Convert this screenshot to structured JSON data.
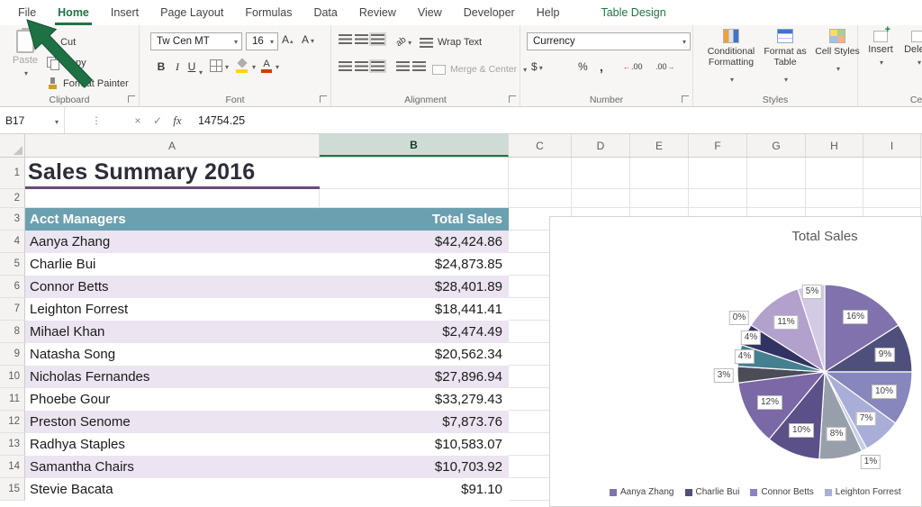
{
  "menu": {
    "tabs": [
      {
        "label": "File"
      },
      {
        "label": "Home",
        "active": true
      },
      {
        "label": "Insert"
      },
      {
        "label": "Page Layout"
      },
      {
        "label": "Formulas"
      },
      {
        "label": "Data"
      },
      {
        "label": "Review"
      },
      {
        "label": "View"
      },
      {
        "label": "Developer"
      },
      {
        "label": "Help"
      },
      {
        "label": "Table Design",
        "contextual": true
      }
    ]
  },
  "ribbon": {
    "clipboard": {
      "label": "Clipboard",
      "paste": "Paste",
      "cut": "Cut",
      "copy": "Copy",
      "format_painter": "Format Painter"
    },
    "font": {
      "label": "Font",
      "font_name": "Tw Cen MT",
      "font_size": "16",
      "bold": "B",
      "italic": "I",
      "underline": "U",
      "grow": "A",
      "shrink": "A"
    },
    "alignment": {
      "label": "Alignment",
      "orientation": "ab",
      "wrap_text": "Wrap Text",
      "merge_center": "Merge & Center"
    },
    "number": {
      "label": "Number",
      "format": "Currency",
      "dollar": "$",
      "percent": "%",
      "comma": ",",
      "decimal": ".00"
    },
    "styles": {
      "label": "Styles",
      "conditional_formatting": "Conditional Formatting",
      "format_as_table": "Format as Table",
      "cell_styles": "Cell Styles"
    },
    "cells": {
      "label": "Cells",
      "insert": "Insert",
      "delete": "Delete"
    }
  },
  "formula_bar": {
    "name_box": "B17",
    "cancel": "×",
    "enter": "✓",
    "fx": "fx",
    "value": "14754.25"
  },
  "sheet": {
    "columns": [
      "A",
      "B",
      "C",
      "D",
      "E",
      "F",
      "G",
      "H",
      "I"
    ],
    "selected_column": "B",
    "title_cell": "Sales Summary 2016",
    "table": {
      "headers": [
        "Acct Managers",
        "Total Sales"
      ],
      "rows": [
        {
          "n": 4,
          "name": "Aanya Zhang",
          "value": "$42,424.86"
        },
        {
          "n": 5,
          "name": "Charlie Bui",
          "value": "$24,873.85"
        },
        {
          "n": 6,
          "name": "Connor Betts",
          "value": "$28,401.89"
        },
        {
          "n": 7,
          "name": "Leighton Forrest",
          "value": "$18,441.41"
        },
        {
          "n": 8,
          "name": "Mihael Khan",
          "value": "$2,474.49"
        },
        {
          "n": 9,
          "name": "Natasha Song",
          "value": "$20,562.34"
        },
        {
          "n": 10,
          "name": "Nicholas Fernandes",
          "value": "$27,896.94"
        },
        {
          "n": 11,
          "name": "Phoebe Gour",
          "value": "$33,279.43"
        },
        {
          "n": 12,
          "name": "Preston Senome",
          "value": "$7,873.76"
        },
        {
          "n": 13,
          "name": "Radhya Staples",
          "value": "$10,583.07"
        },
        {
          "n": 14,
          "name": "Samantha Chairs",
          "value": "$10,703.92"
        },
        {
          "n": 15,
          "name": "Stevie Bacata",
          "value": "$91.10"
        }
      ]
    }
  },
  "chart_data": {
    "type": "pie",
    "title": "Total Sales",
    "legend_position": "bottom",
    "slices": [
      {
        "label": "Aanya Zhang",
        "pct": 16,
        "color": "#8172ad"
      },
      {
        "label": "Charlie Bui",
        "pct": 9,
        "color": "#4f4f7b"
      },
      {
        "label": "Connor Betts",
        "pct": 10,
        "color": "#8787bd"
      },
      {
        "label": "Leighton Forrest",
        "pct": 7,
        "color": "#a9aed8"
      },
      {
        "label": "Mihael Khan",
        "pct": 1,
        "color": "#c9cde8"
      },
      {
        "label": "Natasha Song",
        "pct": 8,
        "color": "#97a0aa"
      },
      {
        "label": "Nicholas Fernandes",
        "pct": 10,
        "color": "#5c5089"
      },
      {
        "label": "Phoebe Gour",
        "pct": 12,
        "color": "#7b68a7"
      },
      {
        "label": "Preston Senome",
        "pct": 3,
        "color": "#4c4c57"
      },
      {
        "label": "Radhya Staples",
        "pct": 4,
        "color": "#44808f"
      },
      {
        "label": "Samantha Chairs",
        "pct": 4,
        "color": "#333363"
      },
      {
        "label": "Stevie Bacata",
        "pct": 0,
        "color": "#9ec2cc"
      },
      {
        "label": "",
        "pct": 11,
        "color": "#b2a0cd"
      },
      {
        "label": "",
        "pct": 5,
        "color": "#d3cae3"
      }
    ],
    "legend_visible": [
      "Aanya Zhang",
      "Charlie Bui",
      "Connor Betts",
      "Leighton Forrest"
    ]
  }
}
